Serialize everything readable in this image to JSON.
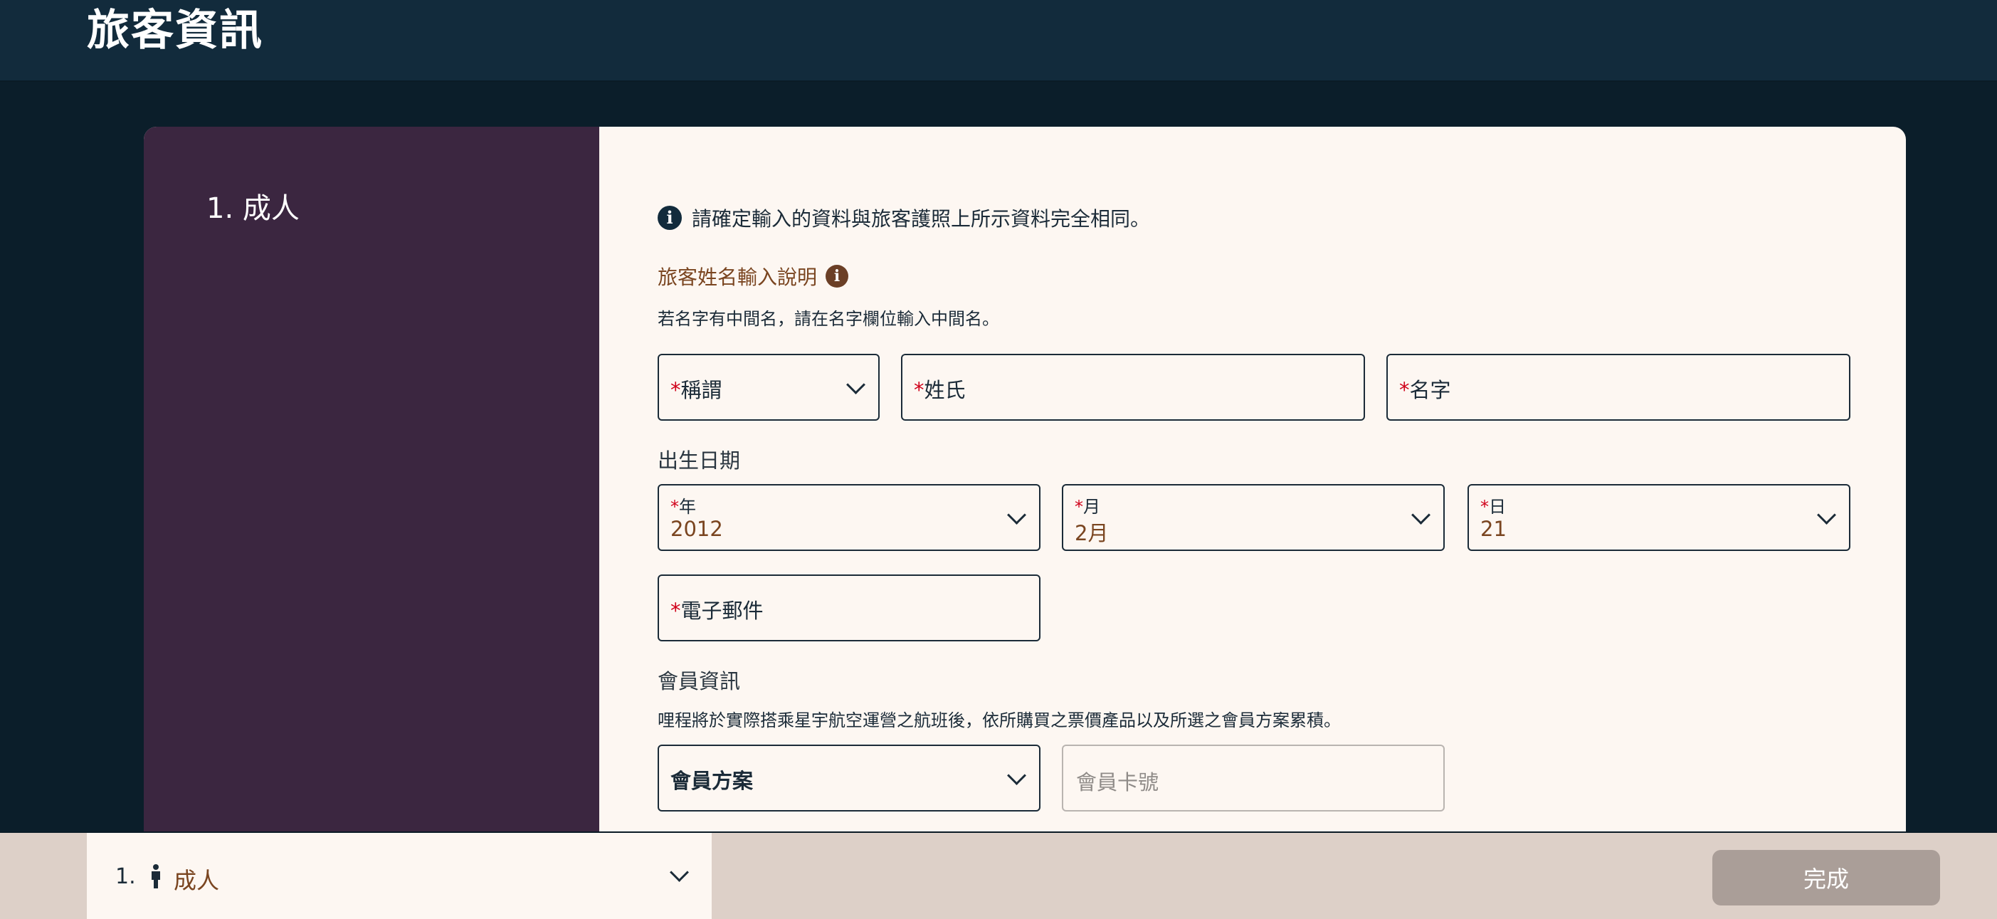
{
  "header": {
    "title": "旅客資訊"
  },
  "passenger_panel": {
    "heading": "1. 成人"
  },
  "form": {
    "notice": "請確定輸入的資料與旅客護照上所示資料完全相同。",
    "name_help_label": "旅客姓名輸入說明",
    "middle_name_hint": "若名字有中間名，請在名字欄位輸入中間名。",
    "required_mark": "*",
    "title_label": "稱謂",
    "surname_label": "姓氏",
    "given_name_label": "名字",
    "dob_section": "出生日期",
    "year_label": "年",
    "year_value": "2012",
    "month_label": "月",
    "month_value": "2月",
    "day_label": "日",
    "day_value": "21",
    "email_label": "電子郵件",
    "membership_section": "會員資訊",
    "membership_hint": "哩程將於實際搭乘星宇航空運營之航班後，依所購買之票價產品以及所選之會員方案累積。",
    "program_label": "會員方案",
    "card_number_placeholder": "會員卡號"
  },
  "bottom_bar": {
    "passenger_number": "1.",
    "passenger_type": "成人",
    "done_label": "完成"
  },
  "icons": {
    "info": "info-circle-icon",
    "chevron": "chevron-down-icon",
    "person": "person-icon"
  },
  "colors": {
    "background": "#0b1e2a",
    "header": "#122b3c",
    "side_panel": "#3b2640",
    "form_bg": "#fdf7f2",
    "accent_brown": "#7a4520",
    "required": "#d0021b",
    "done_button_disabled": "#aa9e98"
  }
}
